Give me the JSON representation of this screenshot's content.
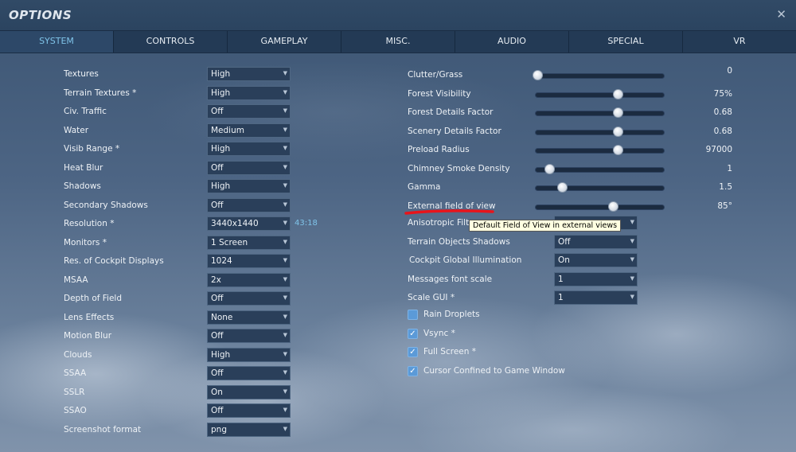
{
  "title": "OPTIONS",
  "close_icon": "close-icon",
  "tabs": [
    {
      "label": "SYSTEM",
      "active": true
    },
    {
      "label": "CONTROLS"
    },
    {
      "label": "GAMEPLAY"
    },
    {
      "label": "MISC."
    },
    {
      "label": "AUDIO"
    },
    {
      "label": "SPECIAL"
    },
    {
      "label": "VR"
    }
  ],
  "left_settings": [
    {
      "label": "Textures",
      "value": "High"
    },
    {
      "label": "Terrain Textures *",
      "value": "High"
    },
    {
      "label": "Civ. Traffic",
      "value": "Off"
    },
    {
      "label": "Water",
      "value": "Medium"
    },
    {
      "label": "Visib Range *",
      "value": "High"
    },
    {
      "label": "Heat Blur",
      "value": "Off"
    },
    {
      "label": "Shadows",
      "value": "High"
    },
    {
      "label": "Secondary Shadows",
      "value": "Off"
    },
    {
      "label": "Resolution *",
      "value": "3440x1440"
    },
    {
      "label": "Monitors *",
      "value": "1 Screen"
    },
    {
      "label": "Res. of Cockpit Displays",
      "value": "1024"
    },
    {
      "label": "MSAA",
      "value": "2x"
    },
    {
      "label": "Depth of Field",
      "value": "Off"
    },
    {
      "label": "Lens Effects",
      "value": "None"
    },
    {
      "label": "Motion Blur",
      "value": "Off"
    },
    {
      "label": "Clouds",
      "value": "High"
    },
    {
      "label": "SSAA",
      "value": "Off"
    },
    {
      "label": "SSLR",
      "value": "On"
    },
    {
      "label": "SSAO",
      "value": "Off"
    },
    {
      "label": "Screenshot format",
      "value": "png"
    }
  ],
  "aspect_ratio": "43:18",
  "sliders": [
    {
      "label": "Clutter/Grass",
      "value": "0",
      "fraction": 0.02
    },
    {
      "label": "Forest Visibility",
      "value": "75%",
      "fraction": 0.64
    },
    {
      "label": "Forest Details Factor",
      "value": "0.68",
      "fraction": 0.64
    },
    {
      "label": "Scenery Details Factor",
      "value": "0.68",
      "fraction": 0.64
    },
    {
      "label": "Preload Radius",
      "value": "97000",
      "fraction": 0.64
    },
    {
      "label": "Chimney Smoke Density",
      "value": "1",
      "fraction": 0.11
    },
    {
      "label": "Gamma",
      "value": "1.5",
      "fraction": 0.21
    },
    {
      "label": "External field of view",
      "value": "85°",
      "fraction": 0.6
    }
  ],
  "right_selects": [
    {
      "label": "Anisotropic Filter",
      "value": ""
    },
    {
      "label": "Terrain Objects Shadows",
      "value": "Off"
    },
    {
      "label": "Cockpit Global Illumination",
      "value": "On"
    },
    {
      "label": "Messages font scale",
      "value": "1"
    },
    {
      "label": "Scale GUI *",
      "value": "1"
    }
  ],
  "checkboxes": [
    {
      "label": "Rain Droplets",
      "checked": false
    },
    {
      "label": "Vsync *",
      "checked": true
    },
    {
      "label": "Full Screen *",
      "checked": true
    },
    {
      "label": "Cursor Confined to Game Window",
      "checked": true
    }
  ],
  "tooltip": "Default Field of View in external views",
  "colors": {
    "accent": "#7fc3e8",
    "annotation": "#e8141b",
    "checkbox": "#5b9ad8"
  }
}
